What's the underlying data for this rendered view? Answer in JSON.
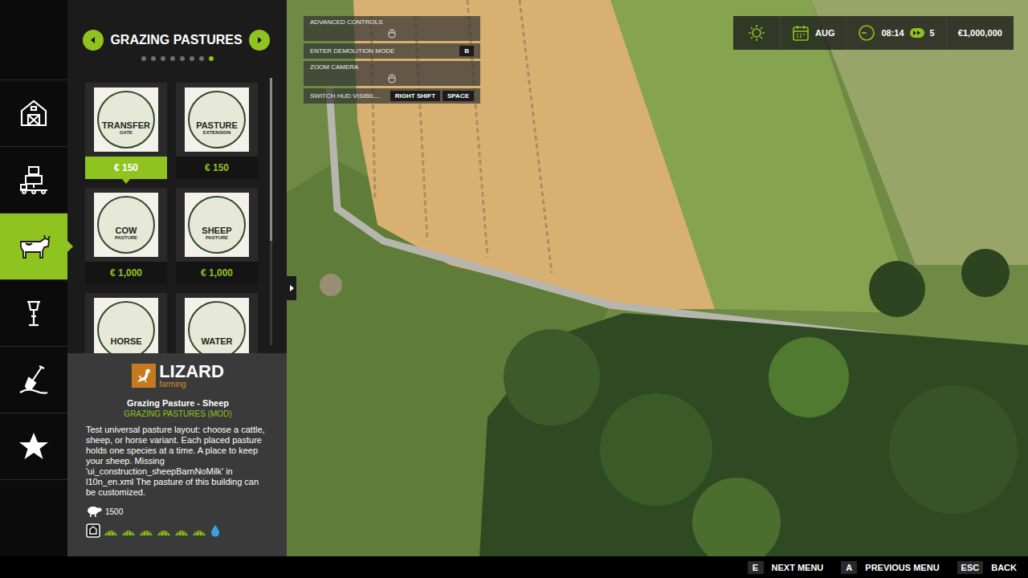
{
  "rail": [
    {
      "selected": false
    },
    {
      "selected": false
    },
    {
      "selected": true
    },
    {
      "selected": false
    },
    {
      "selected": false
    },
    {
      "selected": false
    }
  ],
  "panel": {
    "title": "GRAZING PASTURES",
    "pages": [
      {
        "selected": false
      },
      {
        "selected": false
      },
      {
        "selected": false
      },
      {
        "selected": false
      },
      {
        "selected": false
      },
      {
        "selected": false
      },
      {
        "selected": false
      },
      {
        "selected": true
      }
    ],
    "items": [
      {
        "badge_title": "TRANSFER",
        "badge_sub": "GATE",
        "price": "€ 150",
        "selected": true
      },
      {
        "badge_title": "PASTURE",
        "badge_sub": "EXTENSION",
        "price": "€ 150",
        "selected": false
      },
      {
        "badge_title": "COW",
        "badge_sub": "PASTURE",
        "price": "€ 1,000",
        "selected": false
      },
      {
        "badge_title": "SHEEP",
        "badge_sub": "PASTURE",
        "price": "€ 1,000",
        "selected": false
      },
      {
        "badge_title": "HORSE",
        "selected": false
      },
      {
        "badge_title": "WATER",
        "selected": false
      }
    ],
    "scrollbar": {
      "level": 0.61
    }
  },
  "info": {
    "brand": "LIZARD",
    "brand_sub": "farming",
    "title": "Grazing Pasture - Sheep",
    "category": "GRAZING PASTURES (MOD)",
    "description": "Test universal pasture layout: choose a cattle, sheep, or horse variant. Each placed pasture holds one species at a time. A place to keep your sheep. Missing 'ui_construction_sheepBarnNoMilk' in l10n_en.xml The pasture of this building can be customized.",
    "capacity": "1500",
    "requirements": [
      {
        "kind": "box",
        "color": "#ffffff"
      },
      {
        "kind": "grass",
        "color": "#8fc31f"
      },
      {
        "kind": "grass",
        "color": "#8fc31f"
      },
      {
        "kind": "grass",
        "color": "#8fc31f"
      },
      {
        "kind": "grass",
        "color": "#8fc31f"
      },
      {
        "kind": "grass",
        "color": "#8fc31f"
      },
      {
        "kind": "grass",
        "color": "#8fc31f"
      },
      {
        "kind": "water",
        "color": "#3aa0e0"
      }
    ]
  },
  "hud_controls": [
    {
      "label": "ADVANCED CONTROLS",
      "kind": "mouse",
      "keys": []
    },
    {
      "label": "ENTER DEMOLITION MODE",
      "kind": "keys",
      "keys": [
        "B"
      ]
    },
    {
      "label": "ZOOM CAMERA",
      "kind": "mouse",
      "keys": []
    },
    {
      "label": "SWITCH HUD VISIBIL...",
      "kind": "keys",
      "keys": [
        "RIGHT SHIFT",
        "SPACE"
      ]
    }
  ],
  "status": {
    "month": "AUG",
    "time": "08:14",
    "speed": "5",
    "money": "€1,000,000"
  },
  "footer": [
    {
      "key": "E",
      "label": "NEXT MENU"
    },
    {
      "key": "A",
      "label": "PREVIOUS MENU"
    },
    {
      "key": "ESC",
      "label": "BACK"
    }
  ]
}
